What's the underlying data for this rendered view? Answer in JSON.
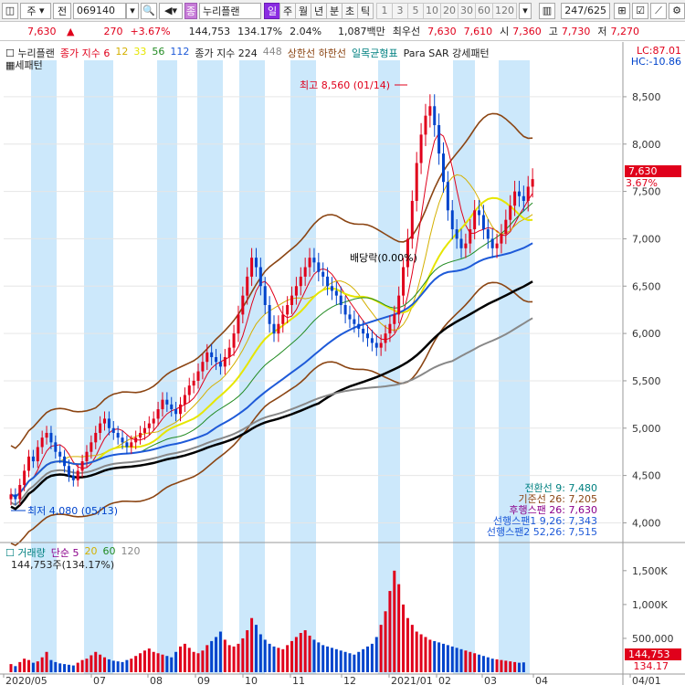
{
  "toolbar": {
    "market": "주",
    "mode": "전",
    "code": "069140",
    "stock_name": "누리플랜",
    "periods": [
      "일",
      "주",
      "월",
      "년",
      "분",
      "초",
      "틱"
    ],
    "numbers": [
      "1",
      "3",
      "5",
      "10",
      "20",
      "30",
      "60",
      "120"
    ],
    "page": "247",
    "page_total": "/625"
  },
  "pricebar": {
    "price": "7,630",
    "arrow": "▲",
    "change": "270",
    "change_pct": "+3.67%",
    "volume": "144,753",
    "volume_pct": "134.17%",
    "turnover": "2.04%",
    "amount": "1,087백만",
    "bid_label": "최우선",
    "bid1": "7,630",
    "bid2": "7,610",
    "open_label": "시",
    "open": "7,360",
    "high_label": "고",
    "high": "7,730",
    "low_label": "저",
    "low": "7,270"
  },
  "legend": {
    "name": "누리플랜",
    "ma_label": "종가 지수 6",
    "ma12": "12",
    "ma33": "33",
    "ma56": "56",
    "ma112": "112",
    "ma224_label": "종가 지수 224",
    "ma448": "448",
    "upper_lower": "상한선 하한선",
    "ichimoku": "일목균형표",
    "para": "Para SAR 강세패턴",
    "line2": "세패턴",
    "lc": "LC:87.01",
    "hc": "HC:-10.86"
  },
  "annotations": {
    "high_label": "최고 8,560 (01/14)",
    "low_label": "최저 4,080 (05/13)",
    "dividend": "배당락(0.00%)"
  },
  "ichimoku_info": [
    "전환선 9: 7,480",
    "기준선 26: 7,205",
    "후행스팬 26: 7,630",
    "선행스팬1 9,26: 7,343",
    "선행스팬2 52,26: 7,515"
  ],
  "price_tag": {
    "price": "7,630",
    "pct": "3.67%"
  },
  "volume_legend": {
    "label": "거래량",
    "ma_label": "단순 5",
    "ma20": "20",
    "ma60": "60",
    "ma120": "120",
    "current": "144,753주(134.17%)"
  },
  "vol_tag": {
    "vol": "144,753",
    "pct": "134.17"
  },
  "price_axis": [
    "8,500",
    "8,000",
    "7,500",
    "7,000",
    "6,500",
    "6,000",
    "5,500",
    "5,000",
    "4,500",
    "4,000"
  ],
  "volume_axis": [
    "1,500K",
    "1,000K",
    "500,000"
  ],
  "date_axis": [
    "2020/05",
    "07",
    "08",
    "09",
    "10",
    "11",
    "12",
    "2021/01",
    "02",
    "03",
    "04",
    "04/01"
  ],
  "colors": {
    "up": "#e0001b",
    "down": "#0044cc",
    "band": "#8b4513",
    "ma_black": "#000000",
    "ma_gray": "#888888",
    "shade": "#cce8fb"
  },
  "chart_data": {
    "type": "candlestick",
    "ylim": [
      3850,
      8750
    ],
    "y_ticks": [
      4000,
      4500,
      5000,
      5500,
      6000,
      6500,
      7000,
      7500,
      8000,
      8500
    ],
    "high": 8560,
    "low": 4080,
    "last_close": 7630,
    "closes": [
      4300,
      4250,
      4400,
      4550,
      4700,
      4650,
      4800,
      4900,
      4950,
      4850,
      4750,
      4700,
      4600,
      4500,
      4450,
      4550,
      4650,
      4750,
      4850,
      4950,
      5050,
      5100,
      5000,
      4950,
      4900,
      4850,
      4800,
      4850,
      4900,
      4950,
      5000,
      5050,
      5100,
      5200,
      5300,
      5250,
      5200,
      5150,
      5250,
      5350,
      5450,
      5500,
      5600,
      5700,
      5800,
      5750,
      5700,
      5650,
      5750,
      5850,
      6000,
      6200,
      6400,
      6600,
      6800,
      6700,
      6500,
      6300,
      6100,
      6000,
      6100,
      6200,
      6300,
      6400,
      6500,
      6600,
      6700,
      6800,
      6750,
      6650,
      6600,
      6500,
      6450,
      6400,
      6300,
      6200,
      6150,
      6100,
      6050,
      6000,
      5950,
      5900,
      5850,
      5900,
      6000,
      6100,
      6200,
      6400,
      6700,
      7000,
      7400,
      7800,
      8100,
      8300,
      8400,
      8200,
      7900,
      7600,
      7300,
      7100,
      7000,
      6900,
      6950,
      7100,
      7300,
      7250,
      7100,
      7000,
      6900,
      6950,
      7050,
      7200,
      7350,
      7500,
      7450,
      7400,
      7550,
      7630
    ],
    "vol_values": [
      120,
      90,
      150,
      200,
      180,
      140,
      160,
      220,
      300,
      180,
      150,
      130,
      120,
      110,
      100,
      140,
      180,
      200,
      250,
      300,
      260,
      220,
      190,
      170,
      160,
      150,
      180,
      200,
      240,
      280,
      320,
      350,
      300,
      280,
      260,
      240,
      220,
      300,
      380,
      420,
      360,
      300,
      280,
      320,
      400,
      460,
      520,
      600,
      480,
      400,
      380,
      420,
      500,
      620,
      800,
      700,
      560,
      480,
      420,
      380,
      360,
      340,
      400,
      460,
      520,
      580,
      620,
      540,
      480,
      440,
      400,
      380,
      360,
      340,
      320,
      300,
      280,
      260,
      300,
      340,
      380,
      420,
      520,
      700,
      900,
      1200,
      1500,
      1300,
      1000,
      800,
      700,
      600,
      560,
      520,
      480,
      460,
      440,
      420,
      400,
      380,
      360,
      340,
      320,
      300,
      280,
      260,
      240,
      220,
      200,
      190,
      180,
      170,
      160,
      150,
      140,
      145
    ]
  }
}
